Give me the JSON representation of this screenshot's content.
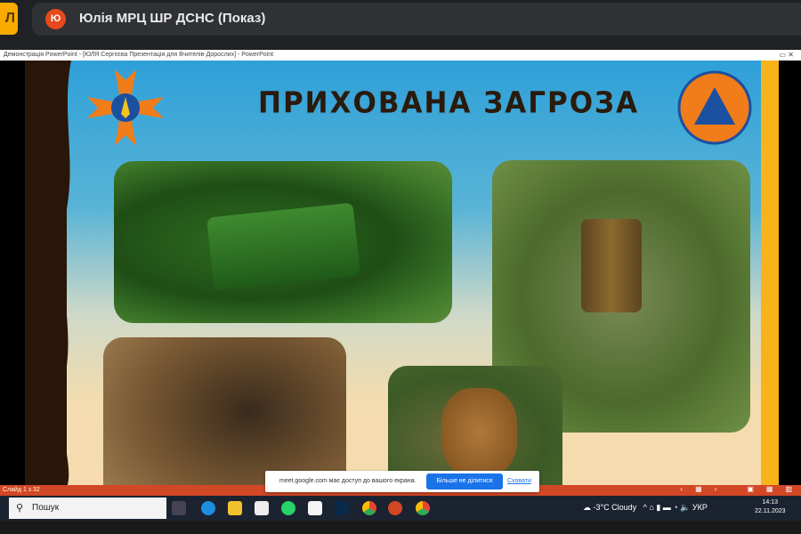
{
  "meet": {
    "avatar_letter": "Ю",
    "presenter_title": "Юлія МРЦ ШР ДСНС (Показ)",
    "app_icon": "Л"
  },
  "window": {
    "title": "Демонстрація PowerPoint - [ЮЛЯ Сергєєва Презентація для Вчителів-Дорослих] - PowerPoint",
    "controls": "▭ ✕"
  },
  "slide": {
    "title": "ПРИХОВАНА ЗАГРОЗА"
  },
  "ppt_status": {
    "slide_counter": "Слайд 1 з 32",
    "controls": [
      "‹",
      "▦",
      "›",
      "▣",
      "▦",
      "▥"
    ]
  },
  "share_bar": {
    "text": "meet.google.com має доступ до вашого екрана.",
    "stop_button": "Більше не ділитися",
    "hide_link": "Сховати"
  },
  "taskbar": {
    "search_placeholder": "Пошук",
    "weather": "-3°C  Cloudy",
    "tray": "^  ⌂  ▮  ▬  ◔  🔈 УКР",
    "time": "14:13",
    "date": "22.11.2023"
  }
}
